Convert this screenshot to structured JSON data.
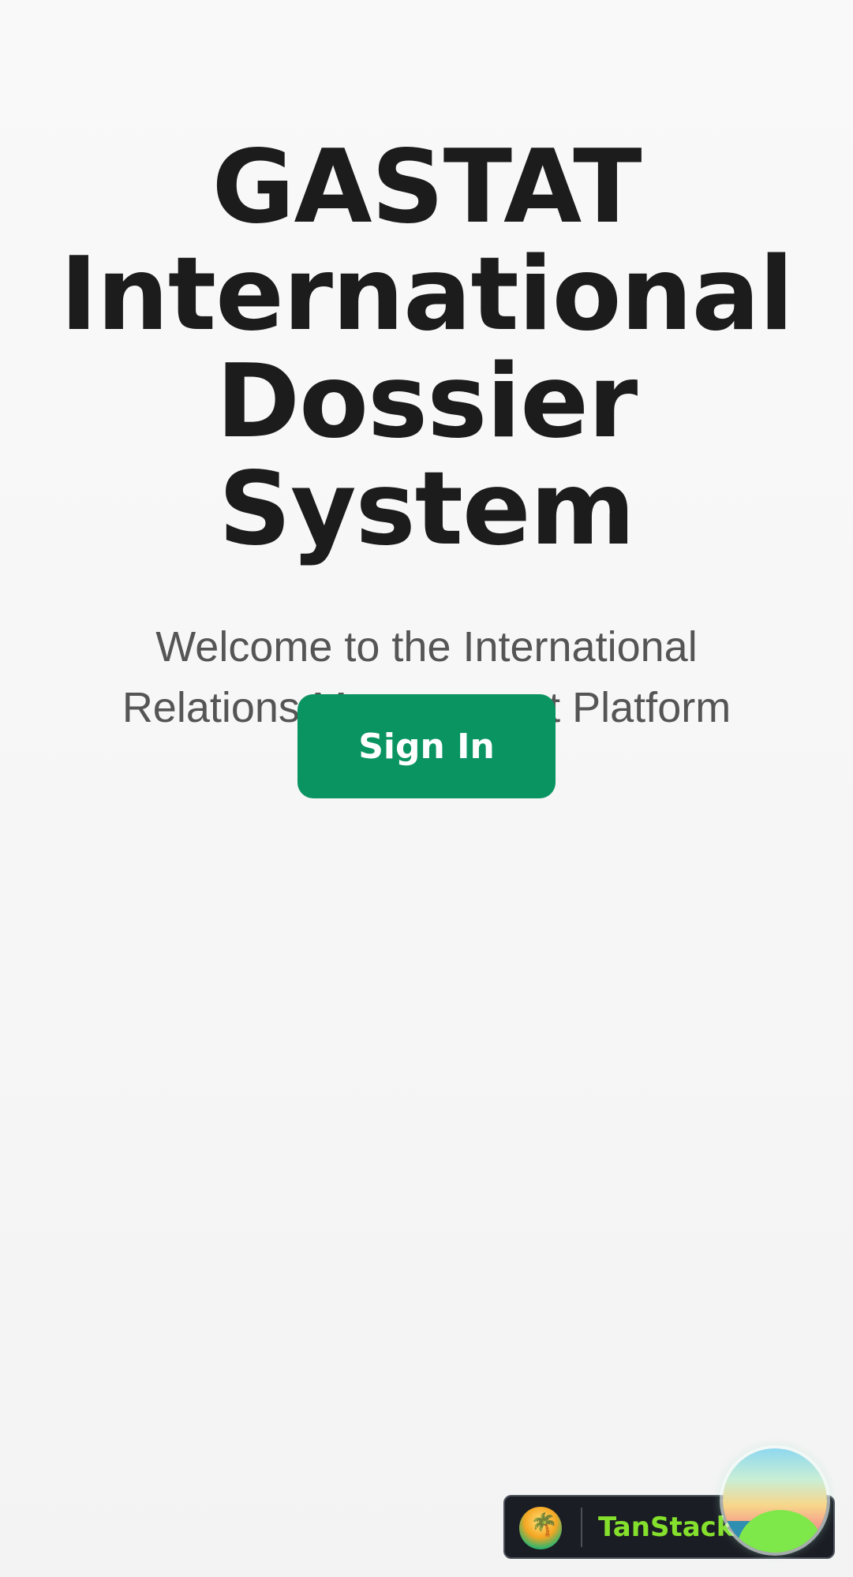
{
  "hero": {
    "title_lines": [
      "GASTAT",
      "International",
      "Dossier System"
    ],
    "subtitle_lines": [
      "Welcome to the International",
      "Relations Management Platform"
    ]
  },
  "auth": {
    "sign_in_label": "Sign In"
  },
  "devtools": {
    "label": "TanStack R",
    "logo_icon": "palm-island-icon",
    "orb_icon": "tanstack-orb-icon"
  },
  "colors": {
    "primary": "#0a9462",
    "title_text": "#1c1c1c",
    "subtitle_text": "#555555",
    "background": "#f7f7f7",
    "devtools_bg": "#1b1d24",
    "devtools_accent": "#84e02c"
  }
}
